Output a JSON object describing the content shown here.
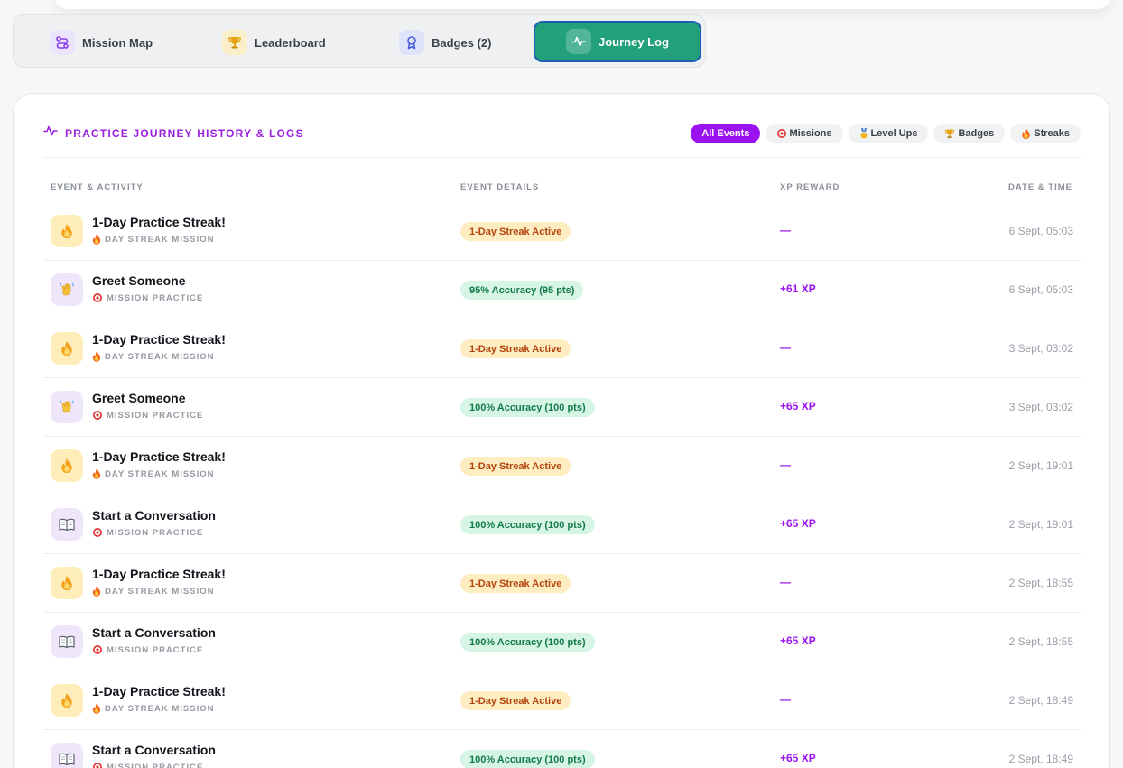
{
  "tabs": [
    {
      "label": "Mission Map",
      "icon": "route-icon"
    },
    {
      "label": "Leaderboard",
      "icon": "trophy-icon"
    },
    {
      "label": "Badges (2)",
      "icon": "medal-icon"
    },
    {
      "label": "Journey Log",
      "icon": "activity-icon",
      "active": true
    }
  ],
  "panel": {
    "title": "PRACTICE JOURNEY HISTORY & LOGS",
    "filters": [
      {
        "label": "All Events",
        "active": true
      },
      {
        "label": "Missions",
        "icon": "target-icon"
      },
      {
        "label": "Level Ups",
        "icon": "medal-icon"
      },
      {
        "label": "Badges",
        "icon": "trophy-icon"
      },
      {
        "label": "Streaks",
        "icon": "fire-icon"
      }
    ],
    "columns": {
      "event": "EVENT & ACTIVITY",
      "details": "EVENT DETAILS",
      "xp": "XP REWARD",
      "date": "DATE & TIME"
    }
  },
  "rows": [
    {
      "kind": "streak",
      "title": "1-Day Practice Streak!",
      "subtitle": "DAY STREAK MISSION",
      "detail": "1-Day Streak Active",
      "xp": "—",
      "date": "6 Sept, 05:03",
      "icon": "fire-icon"
    },
    {
      "kind": "practice",
      "title": "Greet Someone",
      "subtitle": "MISSION PRACTICE",
      "detail": "95% Accuracy (95 pts)",
      "xp": "+61 XP",
      "date": "6 Sept, 05:03",
      "icon": "wave-icon"
    },
    {
      "kind": "streak",
      "title": "1-Day Practice Streak!",
      "subtitle": "DAY STREAK MISSION",
      "detail": "1-Day Streak Active",
      "xp": "—",
      "date": "3 Sept, 03:02",
      "icon": "fire-icon"
    },
    {
      "kind": "practice",
      "title": "Greet Someone",
      "subtitle": "MISSION PRACTICE",
      "detail": "100% Accuracy (100 pts)",
      "xp": "+65 XP",
      "date": "3 Sept, 03:02",
      "icon": "wave-icon"
    },
    {
      "kind": "streak",
      "title": "1-Day Practice Streak!",
      "subtitle": "DAY STREAK MISSION",
      "detail": "1-Day Streak Active",
      "xp": "—",
      "date": "2 Sept, 19:01",
      "icon": "fire-icon"
    },
    {
      "kind": "practice",
      "title": "Start a Conversation",
      "subtitle": "MISSION PRACTICE",
      "detail": "100% Accuracy (100 pts)",
      "xp": "+65 XP",
      "date": "2 Sept, 19:01",
      "icon": "book-icon"
    },
    {
      "kind": "streak",
      "title": "1-Day Practice Streak!",
      "subtitle": "DAY STREAK MISSION",
      "detail": "1-Day Streak Active",
      "xp": "—",
      "date": "2 Sept, 18:55",
      "icon": "fire-icon"
    },
    {
      "kind": "practice",
      "title": "Start a Conversation",
      "subtitle": "MISSION PRACTICE",
      "detail": "100% Accuracy (100 pts)",
      "xp": "+65 XP",
      "date": "2 Sept, 18:55",
      "icon": "book-icon"
    },
    {
      "kind": "streak",
      "title": "1-Day Practice Streak!",
      "subtitle": "DAY STREAK MISSION",
      "detail": "1-Day Streak Active",
      "xp": "—",
      "date": "2 Sept, 18:49",
      "icon": "fire-icon"
    },
    {
      "kind": "practice",
      "title": "Start a Conversation",
      "subtitle": "MISSION PRACTICE",
      "detail": "100% Accuracy (100 pts)",
      "xp": "+65 XP",
      "date": "2 Sept, 18:49",
      "icon": "book-icon"
    }
  ]
}
